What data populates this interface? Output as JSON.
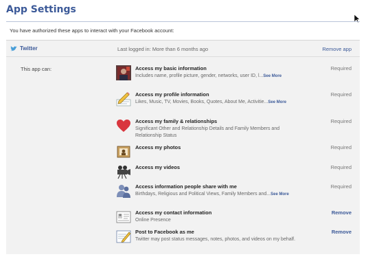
{
  "page_title": "App Settings",
  "intro_text": "You have authorized these apps to interact with your Facebook account:",
  "app": {
    "name": "Twitter",
    "icon": "twitter-bird-icon",
    "last_login": "Last logged in: More than 6 months ago",
    "remove_label": "Remove app"
  },
  "permissions_label": "This app can:",
  "permissions": [
    {
      "icon": "profile-photo-icon",
      "title": "Access my basic information",
      "desc": "Includes name, profile picture, gender, networks, user ID, l...",
      "more": "See More",
      "status": "Required"
    },
    {
      "icon": "pencil-profile-icon",
      "title": "Access my profile information",
      "desc": "Likes, Music, TV, Movies, Books, Quotes, About Me, Activitie...",
      "more": "See More",
      "status": "Required"
    },
    {
      "icon": "heart-icon",
      "title": "Access my family & relationships",
      "desc": "Significant Other and Relationship Details and Family Members and Relationship Status",
      "more": "",
      "status": "Required"
    },
    {
      "icon": "photo-icon",
      "title": "Access my photos",
      "desc": "",
      "more": "",
      "status": "Required"
    },
    {
      "icon": "video-camera-icon",
      "title": "Access my videos",
      "desc": "",
      "more": "",
      "status": "Required"
    },
    {
      "icon": "people-icon",
      "title": "Access information people share with me",
      "desc": "Birthdays, Religious and Political Views, Family Members and...",
      "more": "See More",
      "status": "Required"
    },
    {
      "icon": "contact-card-icon",
      "title": "Access my contact information",
      "desc": "Online Presence",
      "more": "",
      "status": "Remove"
    },
    {
      "icon": "post-note-icon",
      "title": "Post to Facebook as me",
      "desc": "Twitter may post status messages, notes, photos, and videos on my behalf.",
      "more": "",
      "status": "Remove"
    }
  ]
}
